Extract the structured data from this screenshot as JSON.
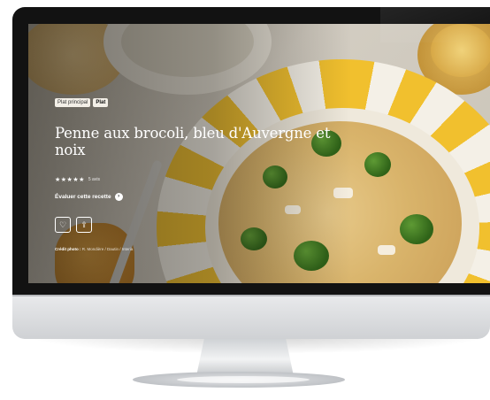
{
  "recipe": {
    "tags": [
      "Plat principal",
      "Plat"
    ],
    "title": "Penne aux brocoli, bleu d'Auvergne et noix",
    "rating": {
      "stars": "★★★★★",
      "votes": "5 avis"
    },
    "evaluate_label": "Évaluer cette recette",
    "actions": {
      "favorite_icon": "heart-icon",
      "share_icon": "share-icon"
    },
    "credit": {
      "label": "Crédit photo :",
      "value": "R. Mondière / Dautin / Interia"
    }
  },
  "colors": {
    "plate_yellow": "#f1c02e",
    "text": "#ffffff",
    "bezel": "#121212"
  }
}
